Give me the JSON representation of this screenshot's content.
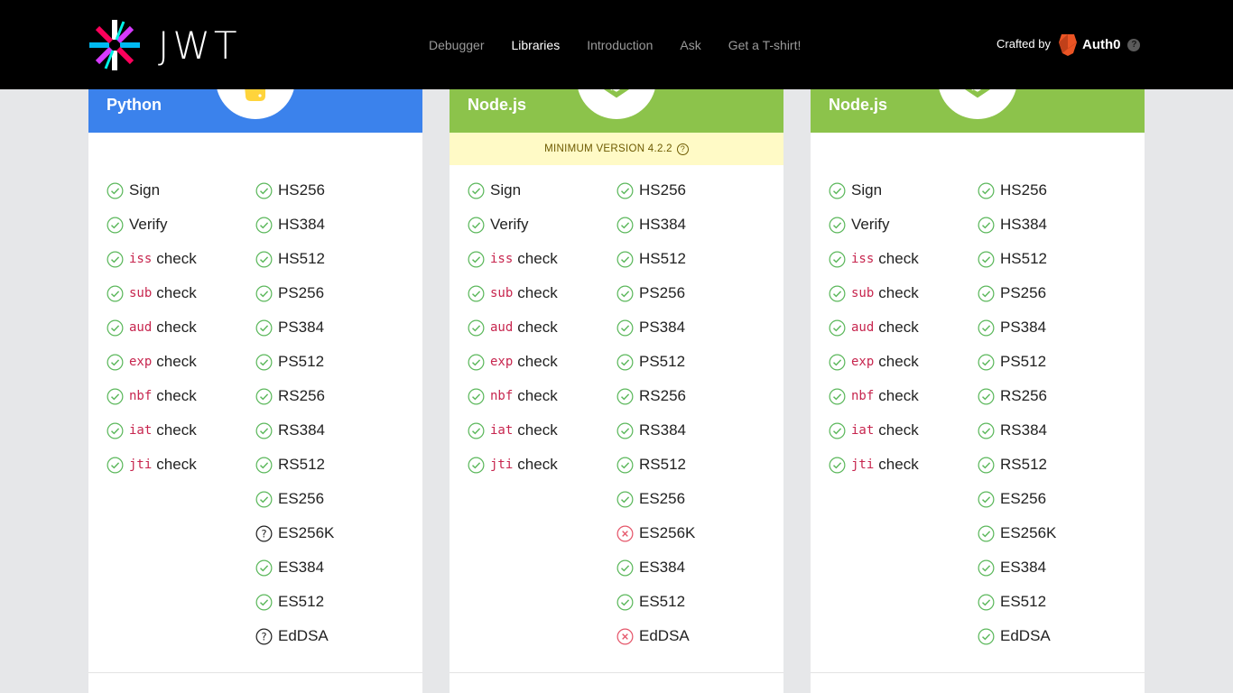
{
  "brand": {
    "logo_text": "JWT"
  },
  "nav": [
    {
      "label": "Debugger",
      "active": false
    },
    {
      "label": "Libraries",
      "active": true
    },
    {
      "label": "Introduction",
      "active": false
    },
    {
      "label": "Ask",
      "active": false
    },
    {
      "label": "Get a T-shirt!",
      "active": false
    }
  ],
  "crafted": {
    "label": "Crafted by",
    "company": "Auth0",
    "help": "?"
  },
  "colors": {
    "ok": "#5cb85c",
    "unknown": "#222222",
    "no": "#e5566a",
    "blue": "#3b82ec",
    "green": "#8cc34b"
  },
  "cards": [
    {
      "language": "Python",
      "header_color": "blue",
      "min_version": "",
      "checks": [
        {
          "code": "",
          "label": "Sign",
          "status": "ok"
        },
        {
          "code": "",
          "label": "Verify",
          "status": "ok"
        },
        {
          "code": "iss",
          "label": "check",
          "status": "ok"
        },
        {
          "code": "sub",
          "label": "check",
          "status": "ok"
        },
        {
          "code": "aud",
          "label": "check",
          "status": "ok"
        },
        {
          "code": "exp",
          "label": "check",
          "status": "ok"
        },
        {
          "code": "nbf",
          "label": "check",
          "status": "ok"
        },
        {
          "code": "iat",
          "label": "check",
          "status": "ok"
        },
        {
          "code": "jti",
          "label": "check",
          "status": "ok"
        }
      ],
      "algorithms": [
        {
          "label": "HS256",
          "status": "ok"
        },
        {
          "label": "HS384",
          "status": "ok"
        },
        {
          "label": "HS512",
          "status": "ok"
        },
        {
          "label": "PS256",
          "status": "ok"
        },
        {
          "label": "PS384",
          "status": "ok"
        },
        {
          "label": "PS512",
          "status": "ok"
        },
        {
          "label": "RS256",
          "status": "ok"
        },
        {
          "label": "RS384",
          "status": "ok"
        },
        {
          "label": "RS512",
          "status": "ok"
        },
        {
          "label": "ES256",
          "status": "ok"
        },
        {
          "label": "ES256K",
          "status": "unknown"
        },
        {
          "label": "ES384",
          "status": "ok"
        },
        {
          "label": "ES512",
          "status": "ok"
        },
        {
          "label": "EdDSA",
          "status": "unknown"
        }
      ]
    },
    {
      "language": "Node.js",
      "header_color": "green",
      "min_version": "MINIMUM VERSION 4.2.2",
      "checks": [
        {
          "code": "",
          "label": "Sign",
          "status": "ok"
        },
        {
          "code": "",
          "label": "Verify",
          "status": "ok"
        },
        {
          "code": "iss",
          "label": "check",
          "status": "ok"
        },
        {
          "code": "sub",
          "label": "check",
          "status": "ok"
        },
        {
          "code": "aud",
          "label": "check",
          "status": "ok"
        },
        {
          "code": "exp",
          "label": "check",
          "status": "ok"
        },
        {
          "code": "nbf",
          "label": "check",
          "status": "ok"
        },
        {
          "code": "iat",
          "label": "check",
          "status": "ok"
        },
        {
          "code": "jti",
          "label": "check",
          "status": "ok"
        }
      ],
      "algorithms": [
        {
          "label": "HS256",
          "status": "ok"
        },
        {
          "label": "HS384",
          "status": "ok"
        },
        {
          "label": "HS512",
          "status": "ok"
        },
        {
          "label": "PS256",
          "status": "ok"
        },
        {
          "label": "PS384",
          "status": "ok"
        },
        {
          "label": "PS512",
          "status": "ok"
        },
        {
          "label": "RS256",
          "status": "ok"
        },
        {
          "label": "RS384",
          "status": "ok"
        },
        {
          "label": "RS512",
          "status": "ok"
        },
        {
          "label": "ES256",
          "status": "ok"
        },
        {
          "label": "ES256K",
          "status": "no"
        },
        {
          "label": "ES384",
          "status": "ok"
        },
        {
          "label": "ES512",
          "status": "ok"
        },
        {
          "label": "EdDSA",
          "status": "no"
        }
      ]
    },
    {
      "language": "Node.js",
      "header_color": "green",
      "min_version": "",
      "checks": [
        {
          "code": "",
          "label": "Sign",
          "status": "ok"
        },
        {
          "code": "",
          "label": "Verify",
          "status": "ok"
        },
        {
          "code": "iss",
          "label": "check",
          "status": "ok"
        },
        {
          "code": "sub",
          "label": "check",
          "status": "ok"
        },
        {
          "code": "aud",
          "label": "check",
          "status": "ok"
        },
        {
          "code": "exp",
          "label": "check",
          "status": "ok"
        },
        {
          "code": "nbf",
          "label": "check",
          "status": "ok"
        },
        {
          "code": "iat",
          "label": "check",
          "status": "ok"
        },
        {
          "code": "jti",
          "label": "check",
          "status": "ok"
        }
      ],
      "algorithms": [
        {
          "label": "HS256",
          "status": "ok"
        },
        {
          "label": "HS384",
          "status": "ok"
        },
        {
          "label": "HS512",
          "status": "ok"
        },
        {
          "label": "PS256",
          "status": "ok"
        },
        {
          "label": "PS384",
          "status": "ok"
        },
        {
          "label": "PS512",
          "status": "ok"
        },
        {
          "label": "RS256",
          "status": "ok"
        },
        {
          "label": "RS384",
          "status": "ok"
        },
        {
          "label": "RS512",
          "status": "ok"
        },
        {
          "label": "ES256",
          "status": "ok"
        },
        {
          "label": "ES256K",
          "status": "ok"
        },
        {
          "label": "ES384",
          "status": "ok"
        },
        {
          "label": "ES512",
          "status": "ok"
        },
        {
          "label": "EdDSA",
          "status": "ok"
        }
      ]
    }
  ]
}
